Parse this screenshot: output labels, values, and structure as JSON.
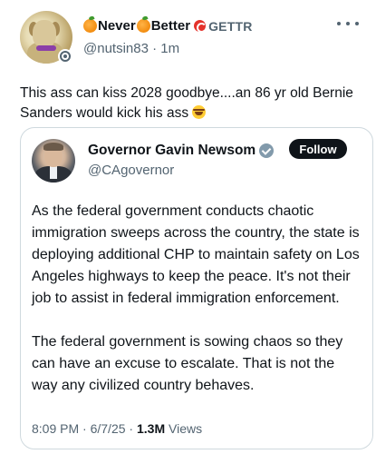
{
  "post": {
    "author_name_parts": [
      "Never",
      "Better"
    ],
    "platform_label": "GETTR",
    "handle": "@nutsin83",
    "separator": " · ",
    "time_ago": "1m",
    "text": "This ass can kiss 2028 goodbye....an 86 yr old Bernie Sanders would kick his ass",
    "icons": [
      "orange-emoji",
      "gettr-logo",
      "more-icon",
      "laughing-emoji",
      "settings-badge-icon"
    ]
  },
  "quoted": {
    "name": "Governor Gavin Newsom",
    "handle": "@CAgovernor",
    "follow_label": "Follow",
    "paragraphs": [
      "As the federal government conducts chaotic immigration sweeps across the country, the state is deploying additional CHP to maintain safety on Los Angeles highways to keep the peace. It's not their job to assist in federal immigration enforcement.",
      "The federal government is sowing chaos so they can have an excuse to escalate. That is not the way any civilized country behaves."
    ],
    "time": "8:09 PM",
    "date": "6/7/25",
    "dot": " · ",
    "views_count": "1.3M",
    "views_label": "Views",
    "badge": "government-verified-badge"
  },
  "colors": {
    "text": "#0f1419",
    "secondary": "#536471",
    "border": "#cfd9de",
    "follow_bg": "#0f1419",
    "gettr_red": "#e4322b",
    "orange": "#f28c0f"
  }
}
